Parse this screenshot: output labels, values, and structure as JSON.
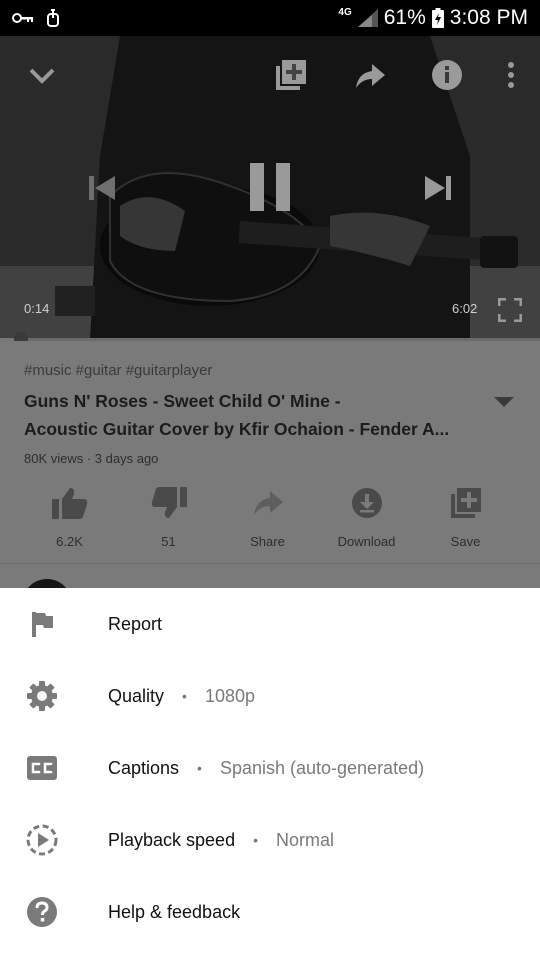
{
  "status_bar": {
    "network": "4G",
    "battery": "61%",
    "time": "3:08 PM",
    "icons": [
      "key-icon",
      "usb-icon",
      "signal-icon",
      "battery-icon"
    ]
  },
  "player": {
    "current_time": "0:14",
    "duration": "6:02",
    "progress": 0.039,
    "controls": [
      "collapse-icon",
      "add-to-playlist-icon",
      "share-icon",
      "info-icon",
      "more-icon",
      "previous-icon",
      "pause-icon",
      "next-icon",
      "fullscreen-icon"
    ]
  },
  "video": {
    "tags": "#music #guitar #guitarplayer",
    "title_line1": "Guns N' Roses - Sweet Child O' Mine -",
    "title_line2": "Acoustic Guitar Cover by Kfir Ochaion - Fender A...",
    "meta": "80K views · 3 days ago"
  },
  "actions": [
    {
      "icon": "thumbs-up-icon",
      "label": "6.2K"
    },
    {
      "icon": "thumbs-down-icon",
      "label": "51"
    },
    {
      "icon": "share-icon",
      "label": "Share"
    },
    {
      "icon": "download-icon",
      "label": "Download"
    },
    {
      "icon": "save-icon",
      "label": "Save"
    }
  ],
  "menu": {
    "items": [
      {
        "icon": "flag-icon",
        "label": "Report",
        "value": ""
      },
      {
        "icon": "gear-icon",
        "label": "Quality",
        "separator": "•",
        "value": "1080p"
      },
      {
        "icon": "captions-icon",
        "label": "Captions",
        "separator": "•",
        "value": "Spanish (auto-generated)"
      },
      {
        "icon": "playback-speed-icon",
        "label": "Playback speed",
        "separator": "•",
        "value": "Normal"
      },
      {
        "icon": "help-icon",
        "label": "Help & feedback",
        "value": ""
      }
    ]
  },
  "colors": {
    "scrim": "#7a7a7a",
    "sheet_bg": "#ffffff",
    "icon_gray": "#7a7a7a",
    "text_primary": "#111111",
    "text_secondary": "#7a7a7a"
  }
}
